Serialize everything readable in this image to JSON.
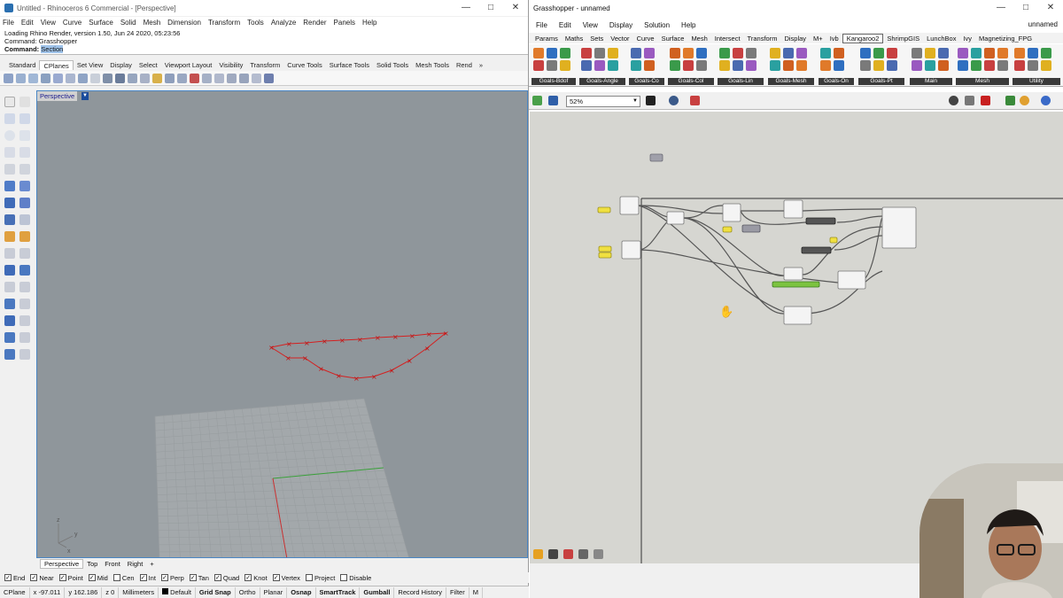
{
  "rhino": {
    "title": "Untitled - Rhinoceros 6 Commercial - [Perspective]",
    "menu": [
      "File",
      "Edit",
      "View",
      "Curve",
      "Surface",
      "Solid",
      "Mesh",
      "Dimension",
      "Transform",
      "Tools",
      "Analyze",
      "Render",
      "Panels",
      "Help"
    ],
    "command_history": [
      "Loading Rhino Render, version 1.50, Jun 24 2020, 05:23:56",
      "Command: Grasshopper"
    ],
    "command_prompt": "Command:",
    "command_input": "Section",
    "toolbar_tabs": [
      "Standard",
      "CPlanes",
      "Set View",
      "Display",
      "Select",
      "Viewport Layout",
      "Visibility",
      "Transform",
      "Curve Tools",
      "Surface Tools",
      "Solid Tools",
      "Mesh Tools",
      "Rend"
    ],
    "toolbar_more": "»",
    "active_tab": "CPlanes",
    "viewport_name": "Perspective",
    "axis_labels": {
      "z": "z",
      "y": "y",
      "x": "x"
    },
    "view_tabs": [
      "Perspective",
      "Top",
      "Front",
      "Right"
    ],
    "view_tabs_add": "+",
    "osnaps": [
      {
        "label": "End",
        "checked": true
      },
      {
        "label": "Near",
        "checked": true
      },
      {
        "label": "Point",
        "checked": true
      },
      {
        "label": "Mid",
        "checked": true
      },
      {
        "label": "Cen",
        "checked": false
      },
      {
        "label": "Int",
        "checked": true
      },
      {
        "label": "Perp",
        "checked": true
      },
      {
        "label": "Tan",
        "checked": true
      },
      {
        "label": "Quad",
        "checked": true
      },
      {
        "label": "Knot",
        "checked": true
      },
      {
        "label": "Vertex",
        "checked": true
      },
      {
        "label": "Project",
        "checked": false
      },
      {
        "label": "Disable",
        "checked": false
      }
    ],
    "status": {
      "cplane": "CPlane",
      "x": "x -97.011",
      "y": "y 162.186",
      "z": "z 0",
      "units": "Millimeters",
      "layer": "Default",
      "toggles": [
        "Grid Snap",
        "Ortho",
        "Planar",
        "Osnap",
        "SmartTrack",
        "Gumball",
        "Record History",
        "Filter",
        "M"
      ]
    },
    "colors": {
      "viewport": "#8f969b",
      "curve": "#d42020",
      "x_axis": "#c83030",
      "y_axis": "#3aa03a"
    }
  },
  "grasshopper": {
    "title": "Grasshopper - unnamed",
    "file_label": "unnamed",
    "menu": [
      "File",
      "Edit",
      "View",
      "Display",
      "Solution",
      "Help"
    ],
    "tabs": [
      "Params",
      "Maths",
      "Sets",
      "Vector",
      "Curve",
      "Surface",
      "Mesh",
      "Intersect",
      "Transform",
      "Display",
      "M+",
      "Ivb",
      "Kangaroo2",
      "ShrimpGIS",
      "LunchBox",
      "Ivy",
      "Magnetizing_FPG"
    ],
    "active_tab": "Kangaroo2",
    "ribbon_groups": [
      "Goals-Bdof",
      "Goals-Angle",
      "Goals-Co",
      "Goals-Col",
      "Goals-Lin",
      "Goals-Mesh",
      "Goals-On",
      "Goals-Pt",
      "Main",
      "Mesh",
      "Utility"
    ],
    "zoom": "52%",
    "canvas_color": "#d6d6d1"
  }
}
